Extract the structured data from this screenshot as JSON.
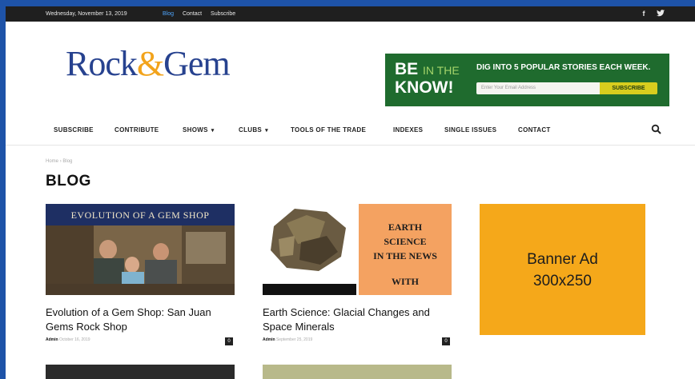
{
  "topbar": {
    "date": "Wednesday, November 13, 2019",
    "links": [
      {
        "label": "Blog",
        "active": true
      },
      {
        "label": "Contact",
        "active": false
      },
      {
        "label": "Subscribe",
        "active": false
      }
    ],
    "social": [
      {
        "glyph": "f",
        "icon": "facebook-icon"
      },
      {
        "glyph": "🐦",
        "icon": "twitter-icon"
      }
    ]
  },
  "logo": {
    "part1": "Rock",
    "amp": "&",
    "part2": "Gem"
  },
  "header_ad": {
    "be": "BE",
    "in_the": "IN THE",
    "know": "KNOW!",
    "tagline": "DIG INTO 5  POPULAR STORIES EACH WEEK.",
    "email_placeholder": "Enter Your Email Address",
    "subscribe": "SUBSCRIBE"
  },
  "nav": {
    "items": [
      "SUBSCRIBE",
      "CONTRIBUTE",
      "SHOWS",
      "CLUBS",
      "TOOLS OF THE TRADE",
      "INDEXES",
      "SINGLE ISSUES",
      "CONTACT"
    ],
    "search_icon": "search-icon"
  },
  "breadcrumb": {
    "home": "Home",
    "sep": "›",
    "current": "Blog"
  },
  "page_title": "BLOG",
  "posts": [
    {
      "thumb_heading": "EVOLUTION OF A GEM SHOP",
      "title": "Evolution of a Gem Shop: San Juan Gems Rock Shop",
      "author": "Admin",
      "date": "October 16, 2019",
      "comments": "0"
    },
    {
      "thumb_text": [
        "EARTH",
        "SCIENCE",
        "IN THE NEWS",
        "WITH"
      ],
      "title": "Earth Science: Glacial Changes and Space Minerals",
      "author": "Admin",
      "date": "September 25, 2019",
      "comments": "0"
    }
  ],
  "sidebar_ad": {
    "line1": "Banner Ad",
    "line2": "300x250"
  },
  "colors": {
    "brand_blue": "#27428f",
    "accent_orange": "#f2a31b",
    "banner_orange": "#f5a81a",
    "link_blue": "#4fa6ff"
  }
}
